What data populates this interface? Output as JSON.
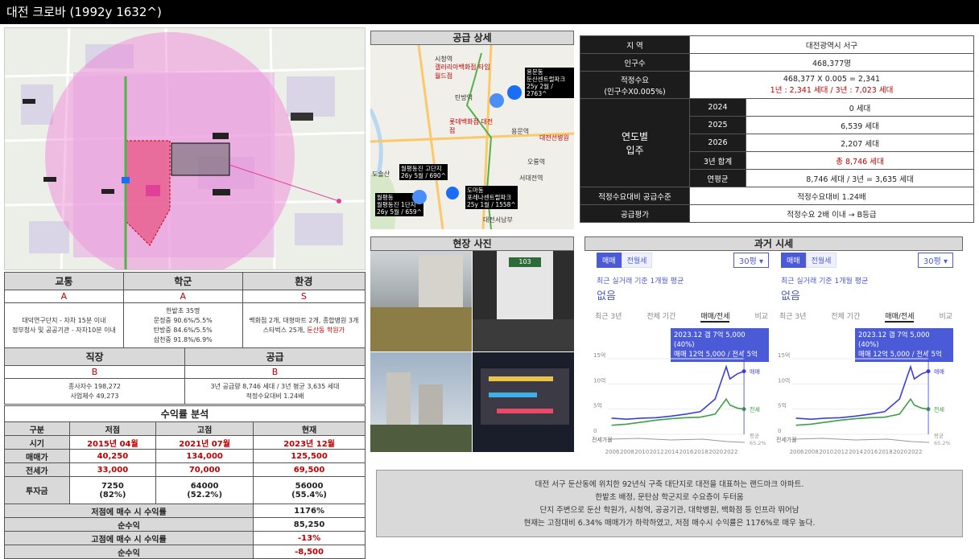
{
  "title": "대전 크로바 (1992y 1632^)",
  "scores": {
    "transport": {
      "label": "교통",
      "grade": "A",
      "lines": [
        "대덕연구단지 - 자차 15분 이내",
        "정부청사 및 공공기관 - 자차10분 이내"
      ]
    },
    "school": {
      "label": "학군",
      "grade": "A",
      "lines": [
        "한밭초 35명",
        "문정중 90.6%/5.5%",
        "탄방중 84.6%/5.5%",
        "삼천중 91.8%/6.9%"
      ]
    },
    "env": {
      "label": "환경",
      "grade": "S",
      "line1": "백화점 2개, 대형마트 2개, 종합병원 3개",
      "line2a": "스타벅스 25개, ",
      "line2b": "둔산동 학원가"
    },
    "job": {
      "label": "직장",
      "grade": "B",
      "lines": [
        "종사자수 198,272",
        "사업체수 49,273"
      ]
    },
    "supply": {
      "label": "공급",
      "grade": "B",
      "lines": [
        "3년 공급량 8,746 세대 / 3년 평균 3,635 세대",
        "적정수요대비 1.24배"
      ]
    }
  },
  "profit": {
    "title": "수익률 분석",
    "cols": [
      "구분",
      "저점",
      "고점",
      "현재"
    ],
    "rows": {
      "period": {
        "label": "시기",
        "v": [
          "2015년 04월",
          "2021년 07월",
          "2023년 12월"
        ]
      },
      "sale": {
        "label": "매매가",
        "v": [
          "40,250",
          "134,000",
          "125,500"
        ]
      },
      "jeonse": {
        "label": "전세가",
        "v": [
          "33,000",
          "70,000",
          "69,500"
        ]
      },
      "invest": {
        "label": "투자금",
        "v": [
          "7250",
          "64000",
          "56000"
        ],
        "p": [
          "(82%)",
          "(52.2%)",
          "(55.4%)"
        ]
      }
    },
    "low_rate_label": "저점에 매수 시 수익률",
    "low_rate": "1176%",
    "low_net_label": "순수익",
    "low_net": "85,250",
    "high_rate_label": "고점에 매수 시 수익률",
    "high_rate": "-13%",
    "high_net_label": "순수익",
    "high_net": "-8,500"
  },
  "supply_detail_title": "공급 상세",
  "supply_map": {
    "labels": {
      "a": "용문동",
      "a2": "둔산센트럴파크",
      "a3": "25y 2월 / 2763^",
      "b": "월평동진 고단지",
      "b2": "26y 5월 / 690^",
      "c": "도마동",
      "c2": "포레나센트럴파크",
      "c3": "25y 1월 / 1558^",
      "d": "월평동",
      "d2": "월평동진 1단지",
      "d3": "26y 5월 / 659^"
    },
    "places": [
      "시청역",
      "갤러리아백화점 타임월드점",
      "탄방역",
      "롯데백화점 대전점",
      "용문역",
      "대전선병원",
      "오룡역",
      "서대전역",
      "도솔산",
      "대전서남부"
    ]
  },
  "site_photo_title": "현장 사진",
  "photo_sign": "103",
  "table": {
    "region_label": "지 역",
    "region": "대전광역시 서구",
    "pop_label": "인구수",
    "pop": "468,377명",
    "demand_label1": "적정수요",
    "demand_label2": "(인구수X0.005%)",
    "demand_calc": "468,377 X 0.005 = 2,341",
    "demand_sub": "1년 : 2,341 세대 / 3년 : 7,023 세대",
    "move_label1": "연도별",
    "move_label2": "입주",
    "years": [
      {
        "y": "2024",
        "v": "0 세대"
      },
      {
        "y": "2025",
        "v": "6,539 세대"
      },
      {
        "y": "2026",
        "v": "2,207 세대"
      }
    ],
    "sum_label": "3년 합계",
    "sum": "총 8,746 세대",
    "avg_label": "연평균",
    "avg": "8,746 세대 / 3년 = 3,635 세대",
    "ratio_label": "적정수요대비 공급수준",
    "ratio": "적정수요대비 1.24배",
    "eval_label": "공급평가",
    "eval": "적정수요 2배 이내 → B등급"
  },
  "past_title": "과거 시세",
  "chart_ui": {
    "tab_sale": "매매",
    "tab_jeonse": "전월세",
    "size": "30평",
    "recent": "최근 실거래 기준 1개월 평균",
    "none": "없음",
    "ranges": [
      "최근 3년",
      "전체 기간",
      "매매/전세",
      "비교"
    ],
    "tip1": "2023.12  갭 7억 5,000 (40%)",
    "tip2": "매매 12억 5,000 / 전세 5억",
    "y_ticks": [
      "15억",
      "10억",
      "5억",
      "0"
    ],
    "x_ticks": [
      "2006",
      "2008",
      "2010",
      "2012",
      "2014",
      "2016",
      "2018",
      "2020",
      "2022"
    ],
    "lbl_sale": "매매",
    "lbl_jeonse": "전세",
    "lbl_rate": "전세가율",
    "lbl_avg": "평균",
    "lbl_avgv": "65.2%"
  },
  "chart_data": {
    "type": "line",
    "x": [
      2006,
      2008,
      2010,
      2012,
      2014,
      2016,
      2018,
      2020,
      2021.5,
      2022,
      2023,
      2023.9
    ],
    "series": [
      {
        "name": "매매",
        "values": [
          3.2,
          3.0,
          3.2,
          3.3,
          3.6,
          4.0,
          4.5,
          7.0,
          13.4,
          11.0,
          12.0,
          12.5
        ]
      },
      {
        "name": "전세",
        "values": [
          1.8,
          2.0,
          2.4,
          2.8,
          3.1,
          3.3,
          3.4,
          4.0,
          7.0,
          5.8,
          5.2,
          5.0
        ]
      }
    ],
    "ylim": [
      0,
      15
    ]
  },
  "summary": [
    "대전 서구 둔산동에 위치한 92년식 구축 대단지로 대전을 대표하는 랜드마크 아파트.",
    "한밭초 배정, 문탄삼 학군지로 수요층이 두터움",
    "단지 주변으로 둔산 학원가, 시청역, 공공기관, 대학병원, 백화점 등 인프라 뛰어남",
    "현재는 고점대비 6.34% 매매가가 하락하였고, 저점 매수시 수익률은 1176%로 매우 높다."
  ]
}
